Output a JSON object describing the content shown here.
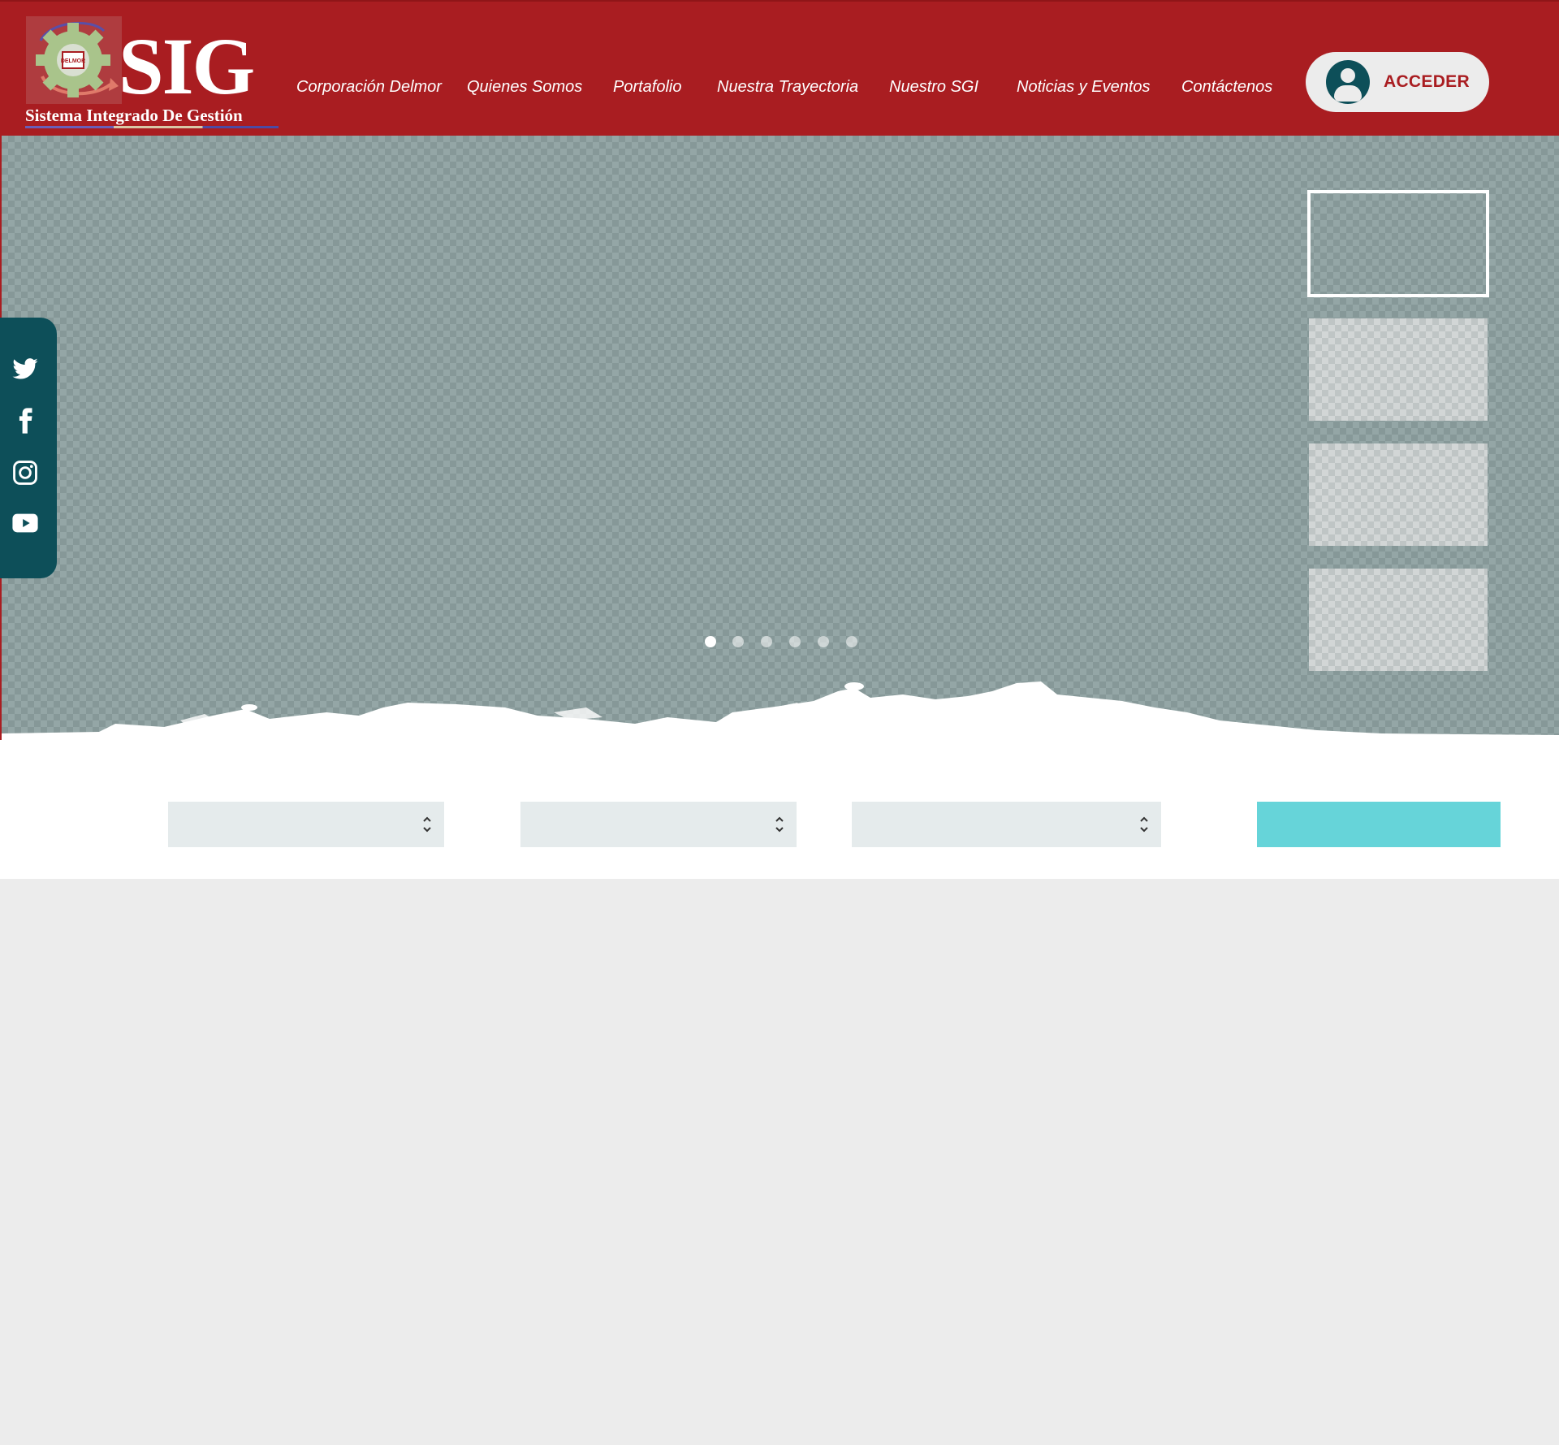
{
  "logo": {
    "title": "SIG",
    "subtitle": "Sistema Integrado De Gestión",
    "badge_text": "DELMOR"
  },
  "nav": {
    "items": [
      {
        "label": "Corporación Delmor"
      },
      {
        "label": "Quienes Somos"
      },
      {
        "label": "Portafolio"
      },
      {
        "label": "Nuestra Trayectoria"
      },
      {
        "label": "Nuestro SGI"
      },
      {
        "label": "Noticias y Eventos"
      },
      {
        "label": "Contáctenos"
      }
    ]
  },
  "login": {
    "label": "ACCEDER",
    "icon": "user-circle-icon"
  },
  "social": {
    "icons": [
      "twitter-icon",
      "facebook-icon",
      "instagram-icon",
      "youtube-icon"
    ]
  },
  "slider": {
    "dot_count": 6,
    "active_dot": 1,
    "thumbnail_count": 4,
    "active_thumbnail": 1
  },
  "filters": {
    "select_1": {
      "value": ""
    },
    "select_2": {
      "value": ""
    },
    "select_3": {
      "value": ""
    },
    "button_label": ""
  },
  "colors": {
    "brand_red": "#a91d21",
    "teal_dark": "#0d4f59",
    "accent_cyan": "#66d4d9"
  }
}
